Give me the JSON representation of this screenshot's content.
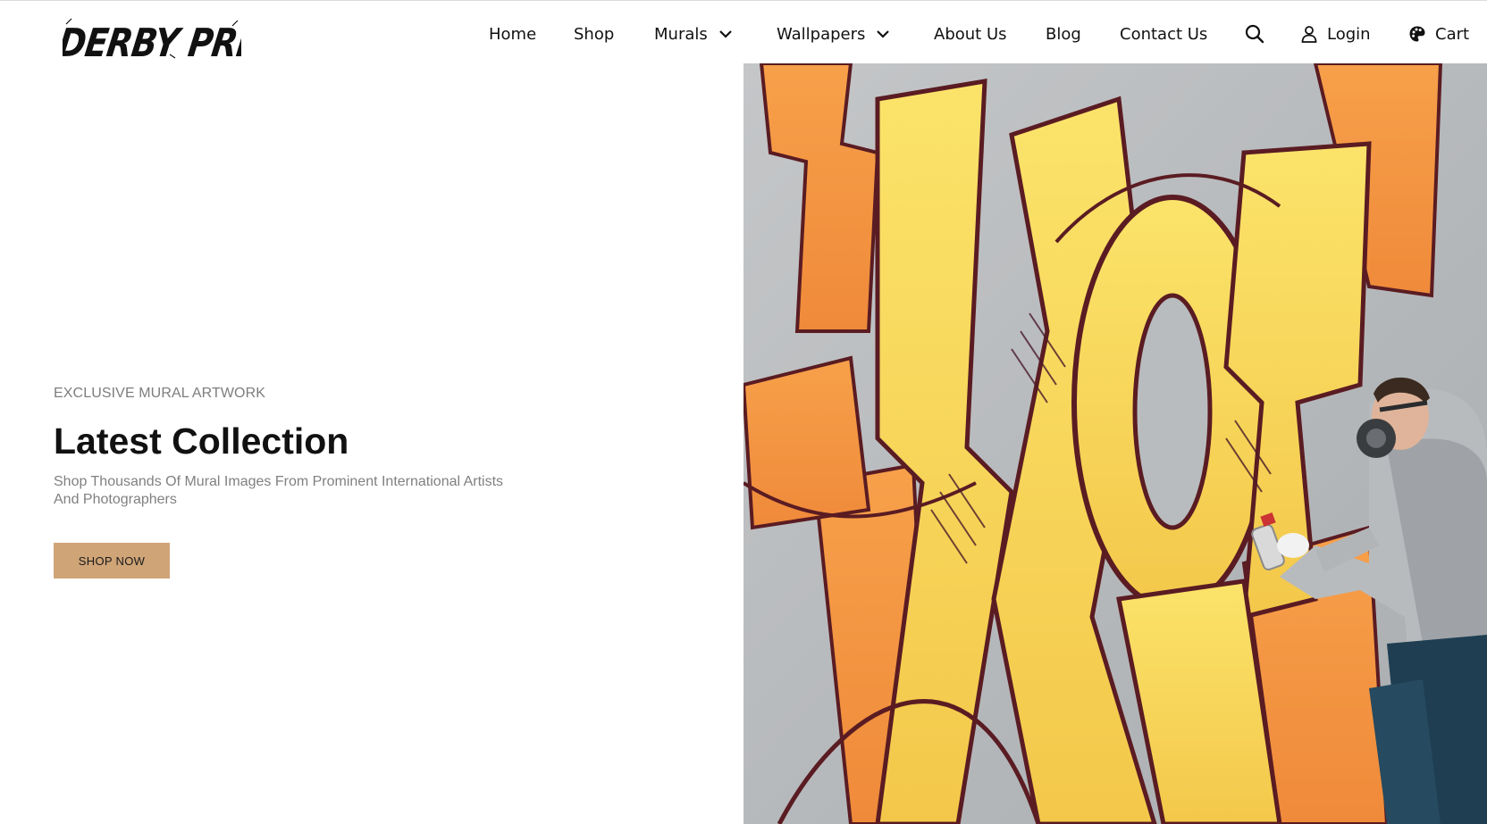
{
  "brand": {
    "logo_text": "DERBY PRINTS"
  },
  "nav": {
    "home": "Home",
    "shop": "Shop",
    "murals": "Murals",
    "wallpapers": "Wallpapers",
    "about": "About Us",
    "blog": "Blog",
    "contact": "Contact Us",
    "login": "Login",
    "cart": "Cart",
    "icons": {
      "dropdown": "chevron-down-icon",
      "search": "search-icon",
      "user": "user-icon",
      "cart": "palette-icon"
    }
  },
  "hero": {
    "eyebrow": "EXCLUSIVE MURAL ARTWORK",
    "title": "Latest Collection",
    "description": "Shop Thousands Of Mural Images From Prominent International Artists And Photographers",
    "button_label": "SHOP NOW",
    "image": "graffiti-artist-painting-mural"
  },
  "colors": {
    "accent": "#cfa477",
    "text": "#111111",
    "muted": "#808080"
  }
}
